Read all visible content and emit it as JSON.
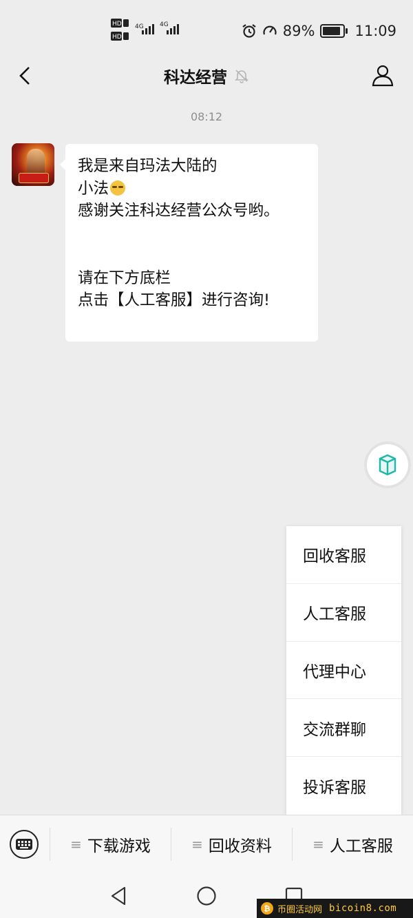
{
  "status_bar": {
    "sim1_label": "HD",
    "sim2_label": "HD",
    "network_label": "4G",
    "battery_text": "89%",
    "battery_level": 0.89,
    "time": "11:09"
  },
  "header": {
    "title": "科达经营"
  },
  "chat": {
    "timestamp": "08:12",
    "message_lines": [
      "我是来自玛法大陆的",
      "小法",
      "感谢关注科达经营公众号哟。",
      "",
      "",
      "请在下方底栏",
      "点击【人工客服】进行咨询!"
    ]
  },
  "popup_menu": {
    "items": [
      "回收客服",
      "人工客服",
      "代理中心",
      "交流群聊",
      "投诉客服"
    ]
  },
  "bottom_menu": {
    "items": [
      "下载游戏",
      "回收资料",
      "人工客服"
    ]
  },
  "watermark": {
    "site_name": "币圈活动网",
    "url": "bicoin8.com"
  },
  "icons": {
    "back": "chevron-left-icon",
    "mute": "bell-off-icon",
    "profile": "person-icon",
    "keyboard": "keyboard-icon",
    "nav_back": "triangle-back-icon",
    "nav_home": "circle-home-icon",
    "nav_recent": "square-recent-icon"
  },
  "colors": {
    "background": "#ededed",
    "bubble": "#ffffff",
    "timestamp": "#8e8e8e"
  }
}
